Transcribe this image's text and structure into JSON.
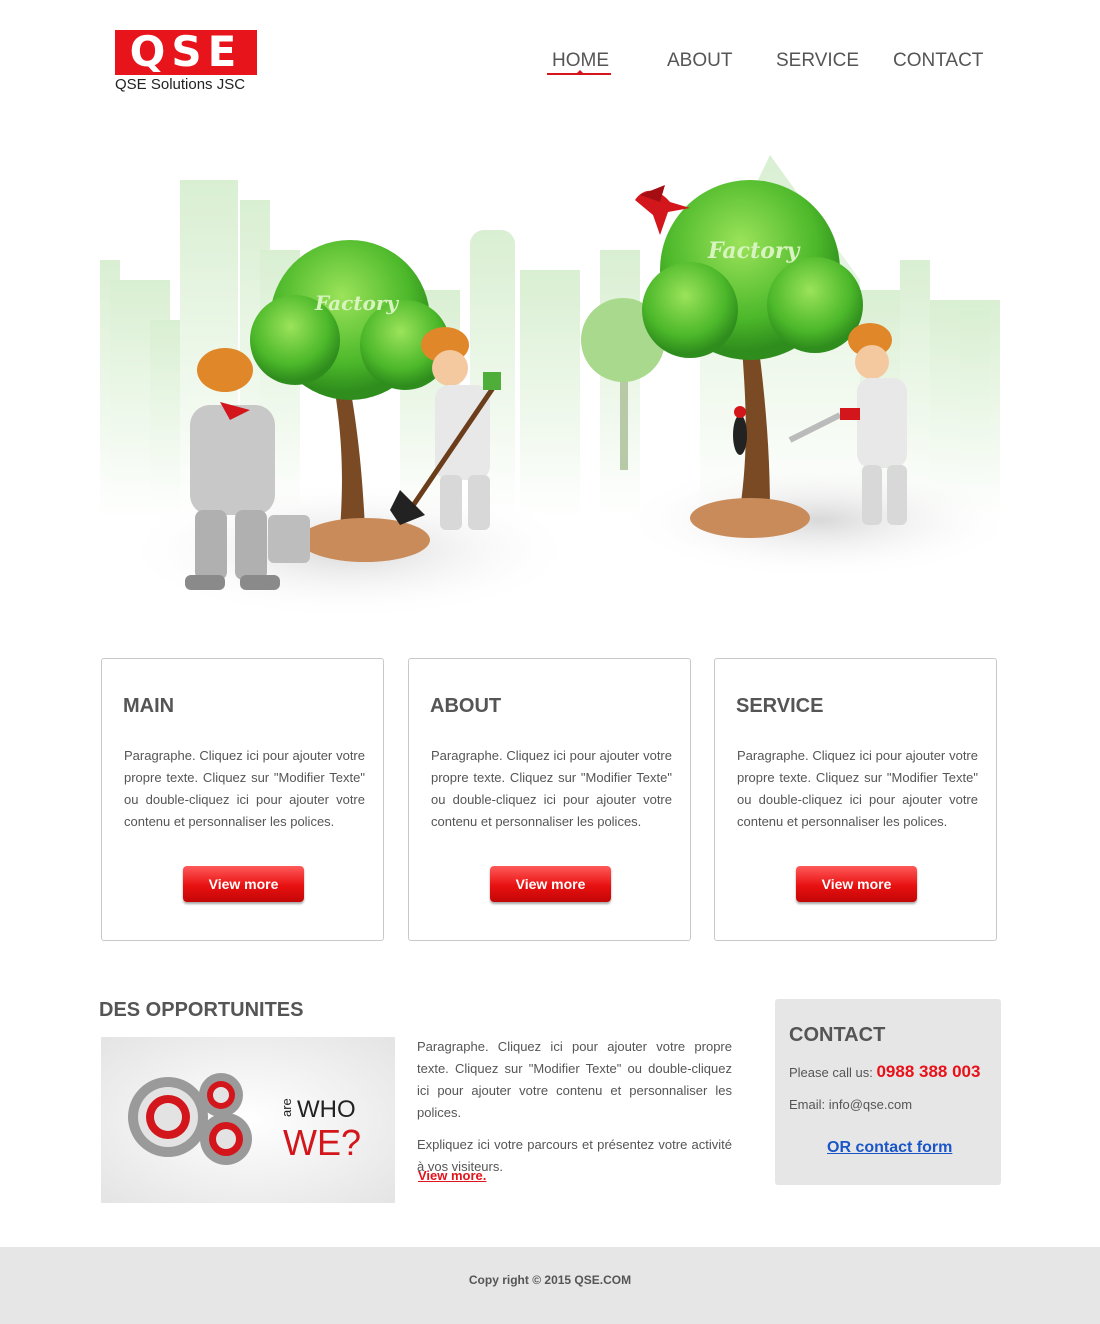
{
  "header": {
    "logo_text": "QSE",
    "logo_subtitle": "QSE Solutions JSC",
    "nav": [
      "HOME",
      "ABOUT",
      "SERVICE",
      "CONTACT"
    ],
    "active_nav": "HOME"
  },
  "hero": {
    "tree_label_1": "Factory",
    "tree_label_2": "Factory"
  },
  "cards": [
    {
      "title": "MAIN",
      "text": "Paragraphe. Cliquez ici pour ajouter votre propre texte. Cliquez sur \"Modifier Texte\" ou double-cliquez ici pour ajouter votre contenu et personnaliser les polices.",
      "button": "View more"
    },
    {
      "title": "ABOUT",
      "text": "Paragraphe. Cliquez ici pour ajouter votre propre texte. Cliquez sur \"Modifier Texte\" ou double-cliquez ici pour ajouter votre contenu et personnaliser les polices.",
      "button": "View more"
    },
    {
      "title": "SERVICE",
      "text": "Paragraphe. Cliquez ici pour ajouter votre propre texte. Cliquez sur \"Modifier Texte\" ou double-cliquez ici pour ajouter votre contenu et personnaliser les polices.",
      "button": "View more"
    }
  ],
  "opportunities": {
    "title": "DES OPPORTUNITES",
    "image_text_are": "are",
    "image_text_who": "WHO",
    "image_text_we": "WE?",
    "paragraph1": "Paragraphe. Cliquez ici pour ajouter votre propre texte. Cliquez sur \"Modifier Texte\" ou double-cliquez ici pour ajouter votre contenu et personnaliser les polices.",
    "paragraph2": "Expliquez ici votre parcours et présentez votre activité à vos visiteurs.",
    "link": "View more."
  },
  "contact": {
    "title": "CONTACT",
    "call_label": "Please call us:",
    "phone": "0988 388 003",
    "email": "Email: info@qse.com",
    "form_link": "OR contact form"
  },
  "footer": {
    "copyright": "Copy right © 2015 QSE.COM"
  },
  "colors": {
    "brand_red": "#e8141c",
    "link_blue": "#1a56c7",
    "panel_gray": "#e6e6e6"
  }
}
